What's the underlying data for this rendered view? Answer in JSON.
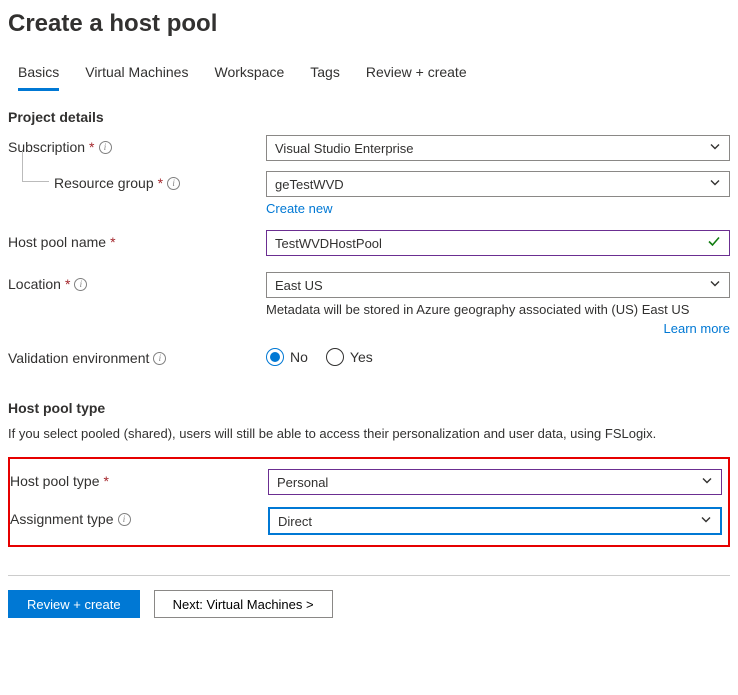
{
  "page": {
    "title": "Create a host pool"
  },
  "tabs": [
    {
      "label": "Basics",
      "active": true
    },
    {
      "label": "Virtual Machines"
    },
    {
      "label": "Workspace"
    },
    {
      "label": "Tags"
    },
    {
      "label": "Review + create"
    }
  ],
  "project": {
    "heading": "Project details",
    "subscription": {
      "label": "Subscription",
      "value": "Visual Studio Enterprise"
    },
    "resource_group": {
      "label": "Resource group",
      "value": "geTestWVD",
      "create_new": "Create new"
    },
    "host_pool_name": {
      "label": "Host pool name",
      "value": "TestWVDHostPool"
    },
    "location": {
      "label": "Location",
      "value": "East US",
      "helper": "Metadata will be stored in Azure geography associated with (US) East US",
      "learn_more": "Learn more"
    },
    "validation_env": {
      "label": "Validation environment",
      "options": {
        "no": "No",
        "yes": "Yes"
      },
      "selected": "no"
    }
  },
  "hostpool": {
    "heading": "Host pool type",
    "desc": "If you select pooled (shared), users will still be able to access their personalization and user data, using FSLogix.",
    "type": {
      "label": "Host pool type",
      "value": "Personal"
    },
    "assignment": {
      "label": "Assignment type",
      "value": "Direct"
    }
  },
  "footer": {
    "review": "Review + create",
    "next": "Next: Virtual Machines >"
  }
}
